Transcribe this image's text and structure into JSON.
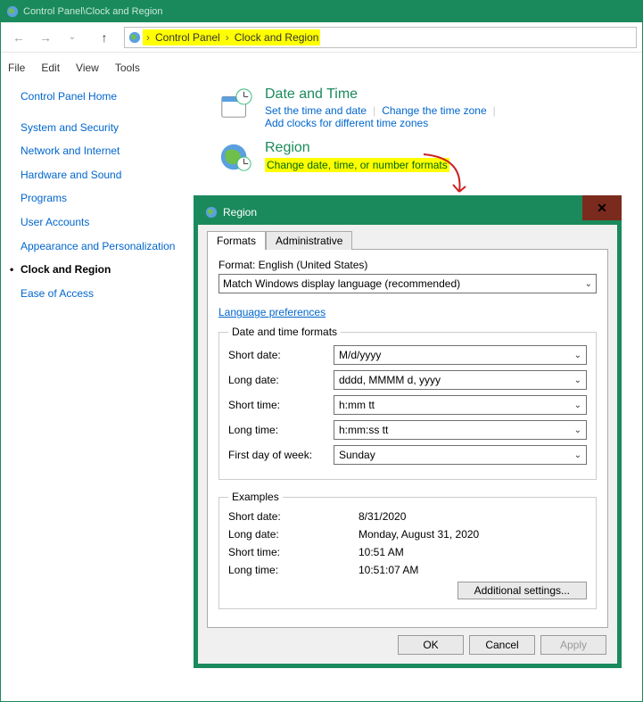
{
  "window": {
    "title": "Control Panel\\Clock and Region"
  },
  "breadcrumb": {
    "root_sep": "›",
    "part1": "Control Panel",
    "part2": "Clock and Region"
  },
  "menu": {
    "file": "File",
    "edit": "Edit",
    "view": "View",
    "tools": "Tools"
  },
  "sidebar": {
    "home": "Control Panel Home",
    "items": [
      "System and Security",
      "Network and Internet",
      "Hardware and Sound",
      "Programs",
      "User Accounts",
      "Appearance and Personalization",
      "Clock and Region",
      "Ease of Access"
    ],
    "active_index": 6
  },
  "categories": {
    "datetime": {
      "title": "Date and Time",
      "links": [
        "Set the time and date",
        "Change the time zone",
        "Add clocks for different time zones"
      ]
    },
    "region": {
      "title": "Region",
      "link": "Change date, time, or number formats"
    }
  },
  "dialog": {
    "title": "Region",
    "tabs": {
      "formats": "Formats",
      "admin": "Administrative"
    },
    "format_label": "Format: English (United States)",
    "format_value": "Match Windows display language (recommended)",
    "lang_prefs": "Language preferences",
    "dtf_legend": "Date and time formats",
    "rows": {
      "short_date": {
        "label": "Short date:",
        "value": "M/d/yyyy"
      },
      "long_date": {
        "label": "Long date:",
        "value": "dddd, MMMM d, yyyy"
      },
      "short_time": {
        "label": "Short time:",
        "value": "h:mm tt"
      },
      "long_time": {
        "label": "Long time:",
        "value": "h:mm:ss tt"
      },
      "first_day": {
        "label": "First day of week:",
        "value": "Sunday"
      }
    },
    "examples_legend": "Examples",
    "examples": {
      "short_date": {
        "label": "Short date:",
        "value": "8/31/2020"
      },
      "long_date": {
        "label": "Long date:",
        "value": "Monday, August 31, 2020"
      },
      "short_time": {
        "label": "Short time:",
        "value": "10:51 AM"
      },
      "long_time": {
        "label": "Long time:",
        "value": "10:51:07 AM"
      }
    },
    "additional": "Additional settings...",
    "ok": "OK",
    "cancel": "Cancel",
    "apply": "Apply"
  }
}
